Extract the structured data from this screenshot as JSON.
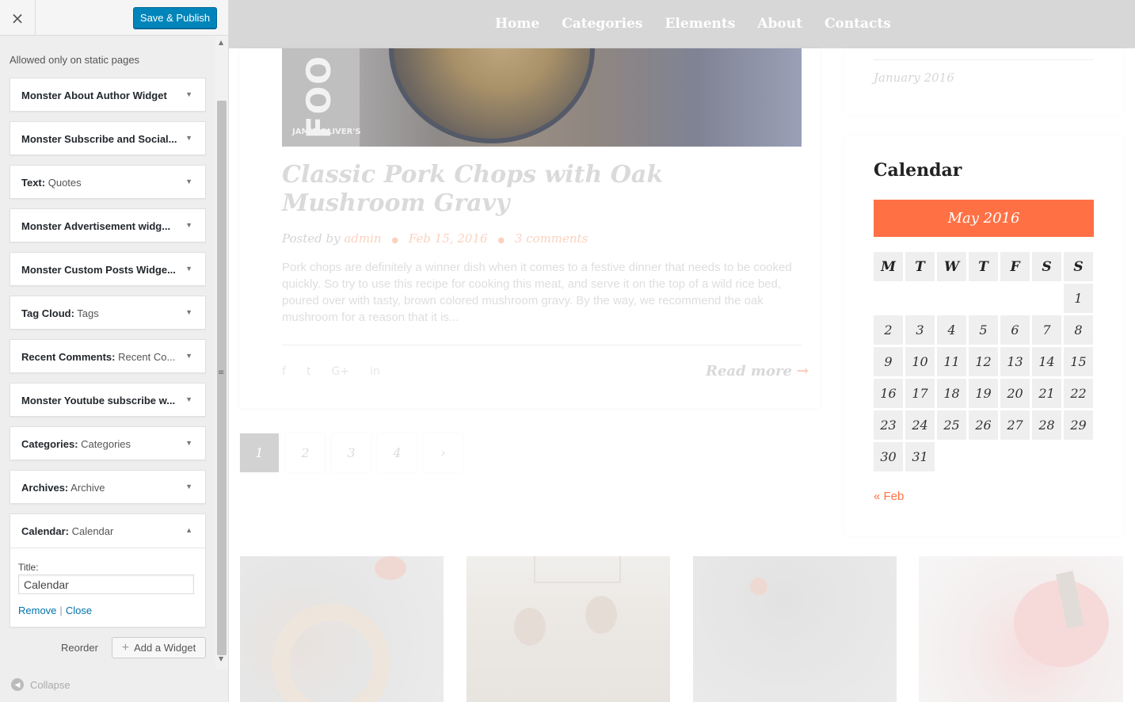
{
  "customizer": {
    "close_label": "×",
    "publish_label": "Save & Publish",
    "note": "Allowed only on static pages",
    "widgets": [
      {
        "name": "Monster About Author Widget",
        "sub": ""
      },
      {
        "name": "Monster Subscribe and Social...",
        "sub": ""
      },
      {
        "name": "Text:",
        "sub": " Quotes"
      },
      {
        "name": "Monster Advertisement widg...",
        "sub": ""
      },
      {
        "name": "Monster Custom Posts Widge...",
        "sub": ""
      },
      {
        "name": "Tag Cloud:",
        "sub": " Tags"
      },
      {
        "name": "Recent Comments:",
        "sub": " Recent Co..."
      },
      {
        "name": "Monster Youtube subscribe w...",
        "sub": ""
      },
      {
        "name": "Categories:",
        "sub": " Categories"
      },
      {
        "name": "Archives:",
        "sub": " Archive"
      }
    ],
    "open_widget": {
      "name": "Calendar:",
      "sub": " Calendar",
      "field_label": "Title:",
      "field_value": "Calendar",
      "remove_label": "Remove",
      "separator": "|",
      "close_label": "Close"
    },
    "reorder_label": "Reorder",
    "add_widget_label": "Add a Widget",
    "collapse_label": "Collapse"
  },
  "site": {
    "nav": [
      "Home",
      "Categories",
      "Elements",
      "About",
      "Contacts"
    ],
    "post": {
      "image_text": "FOO",
      "image_caption": "JAMIE OLIVER'S",
      "title": "Classic Pork Chops with Oak Mushroom Gravy",
      "posted_by": "Posted by",
      "author": "admin",
      "date": "Feb 15, 2016",
      "comments": "3 comments",
      "excerpt": "Pork chops are definitely a winner dish when it comes to a festive dinner that needs to be cooked quickly. So try to use this recipe for cooking this meat, and serve it on the top of a wild rice bed, poured over with tasty, brown colored mushroom gravy. By the way, we recommend the oak mushroom for a reason that it is...",
      "read_more": "Read more",
      "social": [
        "f",
        "t",
        "G+",
        "in"
      ]
    },
    "pagination": [
      "1",
      "2",
      "3",
      "4",
      "›"
    ],
    "archive_item": "January 2016",
    "calendar": {
      "title": "Calendar",
      "month": "May 2016",
      "weekdays": [
        "M",
        "T",
        "W",
        "T",
        "F",
        "S",
        "S"
      ],
      "weeks": [
        [
          "",
          "",
          "",
          "",
          "",
          "",
          "1"
        ],
        [
          "2",
          "3",
          "4",
          "5",
          "6",
          "7",
          "8"
        ],
        [
          "9",
          "10",
          "11",
          "12",
          "13",
          "14",
          "15"
        ],
        [
          "16",
          "17",
          "18",
          "19",
          "20",
          "21",
          "22"
        ],
        [
          "23",
          "24",
          "25",
          "26",
          "27",
          "28",
          "29"
        ],
        [
          "30",
          "31",
          "",
          "",
          "",
          "",
          ""
        ]
      ],
      "prev_link": "« Feb"
    }
  },
  "colors": {
    "accent": "#ff7145",
    "publish_button": "#0085ba",
    "link": "#0073aa"
  }
}
